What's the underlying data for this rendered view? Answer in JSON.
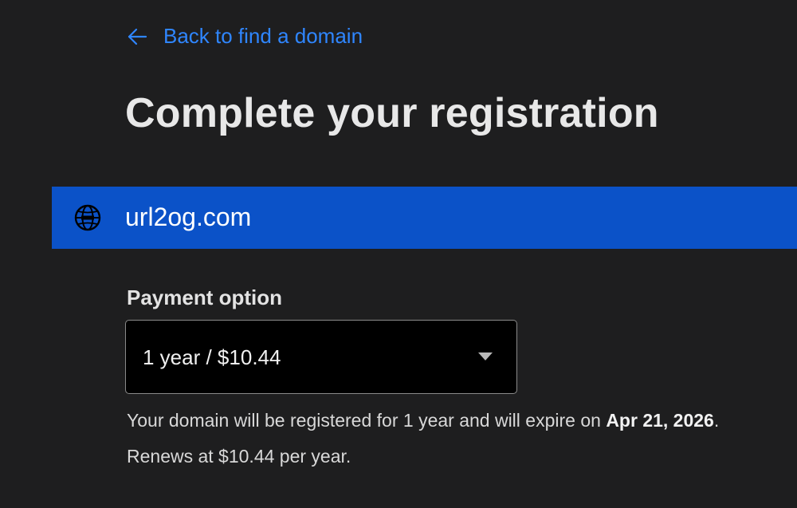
{
  "nav": {
    "back_label": "Back to find a domain",
    "back_icon": "arrow-left-icon"
  },
  "page": {
    "title": "Complete your registration"
  },
  "domain": {
    "name": "url2og.com",
    "icon": "globe-icon",
    "bar_color": "#0b52c8"
  },
  "payment": {
    "label": "Payment option",
    "selected_option": "1 year / $10.44",
    "dropdown_icon": "chevron-down-icon",
    "info_prefix": "Your domain will be registered for 1 year and will expire on ",
    "expiry_date": "Apr 21, 2026",
    "info_suffix": ".",
    "renewal_text": "Renews at $10.44 per year."
  },
  "colors": {
    "background": "#1e1e1f",
    "link": "#2f86ff"
  }
}
